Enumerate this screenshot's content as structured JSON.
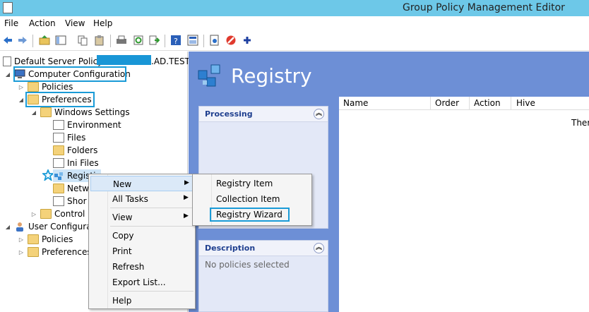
{
  "window": {
    "title": "Group Policy Management Editor"
  },
  "menubar": {
    "file": "File",
    "action": "Action",
    "view": "View",
    "help": "Help"
  },
  "tree": {
    "root": "Default Server Policy",
    "root_suffix": ".AD.TESTL",
    "computer_configuration": "Computer Configuration",
    "policies": "Policies",
    "preferences": "Preferences",
    "windows_settings": "Windows Settings",
    "environment": "Environment",
    "files": "Files",
    "folders": "Folders",
    "ini_files": "Ini Files",
    "registry": "Registi",
    "network": "Netw",
    "shortcuts": "Shor",
    "control_panel": "Control",
    "user_configuration": "User Configurati",
    "user_policies": "Policies",
    "user_preferences": "Preferences"
  },
  "right": {
    "heading": "Registry",
    "processing_title": "Processing",
    "description_title": "Description",
    "description_text": "No policies selected",
    "columns": [
      "Name",
      "Order",
      "Action",
      "Hive"
    ],
    "message": "Ther"
  },
  "context_menu": {
    "items": [
      "New",
      "All Tasks",
      "View",
      "Copy",
      "Print",
      "Refresh",
      "Export List...",
      "Help"
    ]
  },
  "submenu": {
    "items": [
      "Registry Item",
      "Collection Item",
      "Registry Wizard"
    ]
  },
  "colors": {
    "titlebar": "#6dc8e8",
    "highlight_box": "#1a9bd7",
    "right_pane": "#6d8fd6"
  }
}
